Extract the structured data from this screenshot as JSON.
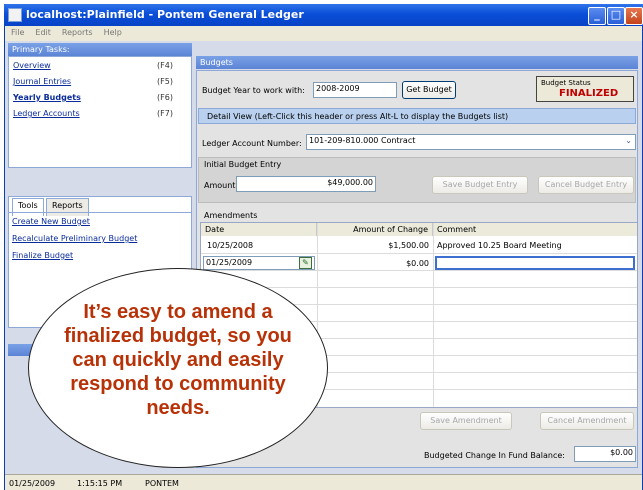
{
  "window": {
    "title": "localhost:Plainfield - Pontem General Ledger"
  },
  "menu": [
    "File",
    "Edit",
    "Reports",
    "Help"
  ],
  "primary_tasks": {
    "header": "Primary Tasks:",
    "items": [
      {
        "label": "Overview",
        "key": "(F4)"
      },
      {
        "label": "Journal Entries",
        "key": "(F5)"
      },
      {
        "label": "Yearly Budgets",
        "key": "(F6)"
      },
      {
        "label": "Ledger Accounts",
        "key": "(F7)"
      }
    ]
  },
  "tools": {
    "tabs": [
      "Tools",
      "Reports"
    ],
    "links": [
      "Create New Budget",
      "Recalculate Preliminary Budget",
      "Finalize Budget"
    ]
  },
  "budgets": {
    "header": "Budgets",
    "year_label": "Budget Year to work with:",
    "year_value": "2008-2009",
    "get_budget": "Get Budget",
    "status_label": "Budget Status",
    "status_value": "FINALIZED",
    "detail_view": "Detail View (Left-Click this header or press Alt-L to display the Budgets list)",
    "account_label": "Ledger Account Number:",
    "account_value": "101-209-810.000  Contract",
    "initial_entry": "Initial Budget Entry",
    "amount_label": "Amount:",
    "amount_value": "$49,000.00",
    "save_entry": "Save Budget Entry",
    "cancel_entry": "Cancel Budget Entry"
  },
  "amendments": {
    "header": "Amendments",
    "columns": [
      "Date",
      "Amount of Change",
      "Comment"
    ],
    "rows": [
      {
        "date": "10/25/2008",
        "amount": "$1,500.00",
        "comment": "Approved 10.25 Board Meeting"
      },
      {
        "date": "01/25/2009",
        "amount": "$0.00",
        "comment": ""
      }
    ],
    "save": "Save Amendment",
    "cancel": "Cancel Amendment"
  },
  "fund_balance": {
    "label": "Budgeted Change In Fund Balance:",
    "value": "$0.00"
  },
  "status_bar": {
    "date": "01/25/2009",
    "time": "1:15:15 PM",
    "user": "PONTEM"
  },
  "callout": "It’s easy to amend a finalized budget, so you can quickly and easily respond to community needs.",
  "colors": {
    "title_blue": "#0a4ed8",
    "status_red": "#c00000",
    "callout_orange": "#b83208"
  }
}
